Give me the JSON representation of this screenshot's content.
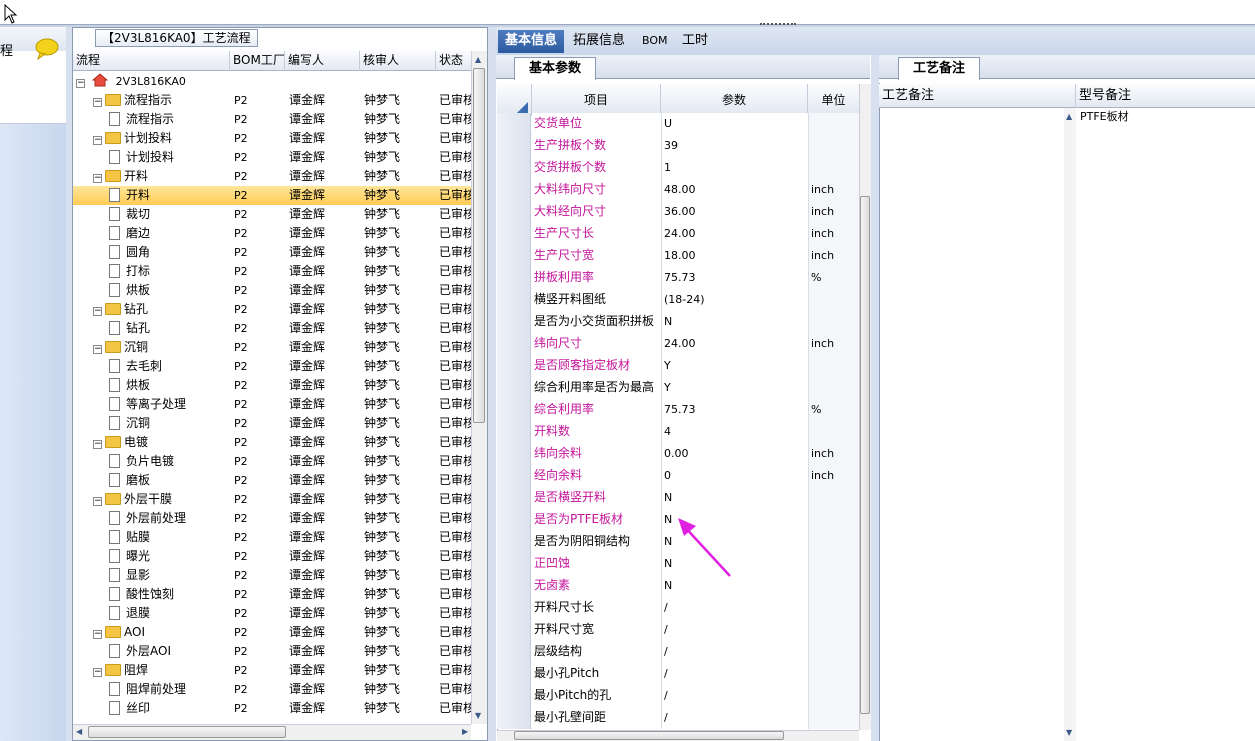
{
  "left": {
    "partial_label": "程"
  },
  "tree": {
    "title": "【2V3L816KA0】工艺流程",
    "columns": [
      "流程",
      "BOM工厂",
      "编写人",
      "核审人",
      "状态"
    ],
    "root": "2V3L816KA0",
    "rows": [
      {
        "name": "流程指示",
        "level": 1,
        "type": "folder",
        "bom": "P2",
        "author": "谭金辉",
        "reviewer": "钟梦飞",
        "status": "已审核"
      },
      {
        "name": "流程指示",
        "level": 2,
        "type": "doc",
        "bom": "P2",
        "author": "谭金辉",
        "reviewer": "钟梦飞",
        "status": "已审核"
      },
      {
        "name": "计划投料",
        "level": 1,
        "type": "folder",
        "bom": "P2",
        "author": "谭金辉",
        "reviewer": "钟梦飞",
        "status": "已审核"
      },
      {
        "name": "计划投料",
        "level": 2,
        "type": "doc",
        "bom": "P2",
        "author": "谭金辉",
        "reviewer": "钟梦飞",
        "status": "已审核"
      },
      {
        "name": "开料",
        "level": 1,
        "type": "folder",
        "bom": "P2",
        "author": "谭金辉",
        "reviewer": "钟梦飞",
        "status": "已审核"
      },
      {
        "name": "开料",
        "level": 2,
        "type": "doc",
        "bom": "P2",
        "author": "谭金辉",
        "reviewer": "钟梦飞",
        "status": "已审核",
        "selected": true
      },
      {
        "name": "裁切",
        "level": 2,
        "type": "doc",
        "bom": "P2",
        "author": "谭金辉",
        "reviewer": "钟梦飞",
        "status": "已审核"
      },
      {
        "name": "磨边",
        "level": 2,
        "type": "doc",
        "bom": "P2",
        "author": "谭金辉",
        "reviewer": "钟梦飞",
        "status": "已审核"
      },
      {
        "name": "圆角",
        "level": 2,
        "type": "doc",
        "bom": "P2",
        "author": "谭金辉",
        "reviewer": "钟梦飞",
        "status": "已审核"
      },
      {
        "name": "打标",
        "level": 2,
        "type": "doc",
        "bom": "P2",
        "author": "谭金辉",
        "reviewer": "钟梦飞",
        "status": "已审核"
      },
      {
        "name": "烘板",
        "level": 2,
        "type": "doc",
        "bom": "P2",
        "author": "谭金辉",
        "reviewer": "钟梦飞",
        "status": "已审核"
      },
      {
        "name": "钻孔",
        "level": 1,
        "type": "folder",
        "bom": "P2",
        "author": "谭金辉",
        "reviewer": "钟梦飞",
        "status": "已审核"
      },
      {
        "name": "钻孔",
        "level": 2,
        "type": "doc",
        "bom": "P2",
        "author": "谭金辉",
        "reviewer": "钟梦飞",
        "status": "已审核"
      },
      {
        "name": "沉铜",
        "level": 1,
        "type": "folder",
        "bom": "P2",
        "author": "谭金辉",
        "reviewer": "钟梦飞",
        "status": "已审核"
      },
      {
        "name": "去毛刺",
        "level": 2,
        "type": "doc",
        "bom": "P2",
        "author": "谭金辉",
        "reviewer": "钟梦飞",
        "status": "已审核"
      },
      {
        "name": "烘板",
        "level": 2,
        "type": "doc",
        "bom": "P2",
        "author": "谭金辉",
        "reviewer": "钟梦飞",
        "status": "已审核"
      },
      {
        "name": "等离子处理",
        "level": 2,
        "type": "doc",
        "bom": "P2",
        "author": "谭金辉",
        "reviewer": "钟梦飞",
        "status": "已审核"
      },
      {
        "name": "沉铜",
        "level": 2,
        "type": "doc",
        "bom": "P2",
        "author": "谭金辉",
        "reviewer": "钟梦飞",
        "status": "已审核"
      },
      {
        "name": "电镀",
        "level": 1,
        "type": "folder",
        "bom": "P2",
        "author": "谭金辉",
        "reviewer": "钟梦飞",
        "status": "已审核"
      },
      {
        "name": "负片电镀",
        "level": 2,
        "type": "doc",
        "bom": "P2",
        "author": "谭金辉",
        "reviewer": "钟梦飞",
        "status": "已审核"
      },
      {
        "name": "磨板",
        "level": 2,
        "type": "doc",
        "bom": "P2",
        "author": "谭金辉",
        "reviewer": "钟梦飞",
        "status": "已审核"
      },
      {
        "name": "外层干膜",
        "level": 1,
        "type": "folder",
        "bom": "P2",
        "author": "谭金辉",
        "reviewer": "钟梦飞",
        "status": "已审核"
      },
      {
        "name": "外层前处理",
        "level": 2,
        "type": "doc",
        "bom": "P2",
        "author": "谭金辉",
        "reviewer": "钟梦飞",
        "status": "已审核"
      },
      {
        "name": "贴膜",
        "level": 2,
        "type": "doc",
        "bom": "P2",
        "author": "谭金辉",
        "reviewer": "钟梦飞",
        "status": "已审核"
      },
      {
        "name": "曝光",
        "level": 2,
        "type": "doc",
        "bom": "P2",
        "author": "谭金辉",
        "reviewer": "钟梦飞",
        "status": "已审核"
      },
      {
        "name": "显影",
        "level": 2,
        "type": "doc",
        "bom": "P2",
        "author": "谭金辉",
        "reviewer": "钟梦飞",
        "status": "已审核"
      },
      {
        "name": "酸性蚀刻",
        "level": 2,
        "type": "doc",
        "bom": "P2",
        "author": "谭金辉",
        "reviewer": "钟梦飞",
        "status": "已审核"
      },
      {
        "name": "退膜",
        "level": 2,
        "type": "doc",
        "bom": "P2",
        "author": "谭金辉",
        "reviewer": "钟梦飞",
        "status": "已审核"
      },
      {
        "name": "AOI",
        "level": 1,
        "type": "folder",
        "bom": "P2",
        "author": "谭金辉",
        "reviewer": "钟梦飞",
        "status": "已审核"
      },
      {
        "name": "外层AOI",
        "level": 2,
        "type": "doc",
        "bom": "P2",
        "author": "谭金辉",
        "reviewer": "钟梦飞",
        "status": "已审核"
      },
      {
        "name": "阻焊",
        "level": 1,
        "type": "folder",
        "bom": "P2",
        "author": "谭金辉",
        "reviewer": "钟梦飞",
        "status": "已审核"
      },
      {
        "name": "阻焊前处理",
        "level": 2,
        "type": "doc",
        "bom": "P2",
        "author": "谭金辉",
        "reviewer": "钟梦飞",
        "status": "已审核"
      },
      {
        "name": "丝印",
        "level": 2,
        "type": "doc",
        "bom": "P2",
        "author": "谭金辉",
        "reviewer": "钟梦飞",
        "status": "已审核"
      }
    ]
  },
  "tabs": [
    "基本信息",
    "拓展信息",
    "BOM",
    "工时"
  ],
  "params": {
    "subtab": "基本参数",
    "columns": [
      "项目",
      "参数",
      "单位"
    ],
    "rows": [
      {
        "name": "交货单位",
        "value": "U",
        "unit": "",
        "pink": true
      },
      {
        "name": "生产拼板个数",
        "value": "39",
        "unit": "",
        "pink": true
      },
      {
        "name": "交货拼板个数",
        "value": "1",
        "unit": "",
        "pink": true
      },
      {
        "name": "大料纬向尺寸",
        "value": "48.00",
        "unit": "inch",
        "pink": true
      },
      {
        "name": "大料经向尺寸",
        "value": "36.00",
        "unit": "inch",
        "pink": true
      },
      {
        "name": "生产尺寸长",
        "value": "24.00",
        "unit": "inch",
        "pink": true
      },
      {
        "name": "生产尺寸宽",
        "value": "18.00",
        "unit": "inch",
        "pink": true
      },
      {
        "name": "拼板利用率",
        "value": "75.73",
        "unit": "%",
        "pink": true
      },
      {
        "name": "横竖开料图纸",
        "value": "(18-24)",
        "unit": "",
        "pink": false
      },
      {
        "name": "是否为小交货面积拼板",
        "value": "N",
        "unit": "",
        "pink": false
      },
      {
        "name": "纬向尺寸",
        "value": "24.00",
        "unit": "inch",
        "pink": true
      },
      {
        "name": "是否顾客指定板材",
        "value": "Y",
        "unit": "",
        "pink": true
      },
      {
        "name": "综合利用率是否为最高",
        "value": "Y",
        "unit": "",
        "pink": false
      },
      {
        "name": "综合利用率",
        "value": "75.73",
        "unit": "%",
        "pink": true
      },
      {
        "name": "开料数",
        "value": "4",
        "unit": "",
        "pink": true
      },
      {
        "name": "纬向余料",
        "value": "0.00",
        "unit": "inch",
        "pink": true
      },
      {
        "name": "经向余料",
        "value": "0",
        "unit": "inch",
        "pink": true
      },
      {
        "name": "是否横竖开料",
        "value": "N",
        "unit": "",
        "pink": true
      },
      {
        "name": "是否为PTFE板材",
        "value": "N",
        "unit": "",
        "pink": true
      },
      {
        "name": "是否为阴阳铜结构",
        "value": "N",
        "unit": "",
        "pink": false
      },
      {
        "name": "正凹蚀",
        "value": "N",
        "unit": "",
        "pink": true
      },
      {
        "name": "无卤素",
        "value": "N",
        "unit": "",
        "pink": true
      },
      {
        "name": "开料尺寸长",
        "value": "/",
        "unit": "",
        "pink": false
      },
      {
        "name": "开料尺寸宽",
        "value": "/",
        "unit": "",
        "pink": false
      },
      {
        "name": "层级结构",
        "value": "/",
        "unit": "",
        "pink": false
      },
      {
        "name": "最小孔Pitch",
        "value": "/",
        "unit": "",
        "pink": false
      },
      {
        "name": "最小Pitch的孔",
        "value": "/",
        "unit": "",
        "pink": false
      },
      {
        "name": "最小孔壁间距",
        "value": "/",
        "unit": "",
        "pink": false
      }
    ]
  },
  "notes": {
    "tab": "工艺备注",
    "col1": "工艺备注",
    "col2": "型号备注",
    "model_note": "PTFE板材"
  },
  "colors": {
    "accent": "#2c5aa0",
    "pink_label": "#c4149a",
    "arrow": "#e020e0",
    "selected_row": "#ffd86b"
  }
}
